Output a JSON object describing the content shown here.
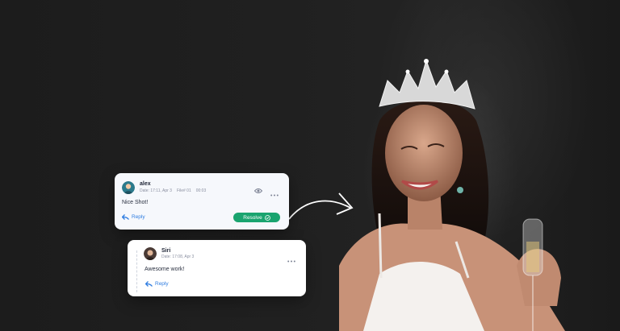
{
  "comments": [
    {
      "author": "alex",
      "date": "Date: 17:11, Apr 3",
      "file": "File# 01",
      "time": "00:03",
      "text": "Nice Shot!",
      "reply_label": "Reply",
      "resolve_label": "Resolve",
      "icons": [
        "eye-icon",
        "more-options-icon",
        "reply-icon",
        "check-circle-icon"
      ]
    },
    {
      "author": "Siri",
      "date": "Date: 17:08, Apr 3",
      "text": "Awesome work!",
      "reply_label": "Reply",
      "icons": [
        "more-options-icon",
        "reply-icon"
      ]
    }
  ],
  "colors": {
    "accent_blue": "#2f7de1",
    "resolve_green": "#1aa46f",
    "background": "#1f1f1f"
  }
}
